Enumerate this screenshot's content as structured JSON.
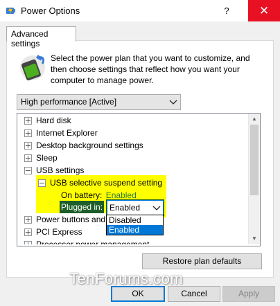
{
  "window": {
    "title": "Power Options",
    "help_glyph": "?",
    "close_glyph": "✕"
  },
  "tab": {
    "label": "Advanced settings"
  },
  "description": "Select the power plan that you want to customize, and then choose settings that reflect how you want your computer to manage power.",
  "plan_select": {
    "value": "High performance [Active]"
  },
  "tree": {
    "items": [
      {
        "label": "Hard disk",
        "expanded": false
      },
      {
        "label": "Internet Explorer",
        "expanded": false
      },
      {
        "label": "Desktop background settings",
        "expanded": false
      },
      {
        "label": "Sleep",
        "expanded": false
      },
      {
        "label": "USB settings",
        "expanded": true
      },
      {
        "label": "USB selective suspend setting",
        "expanded": true
      },
      {
        "label": "On battery:",
        "value": "Enabled"
      },
      {
        "label": "Plugged in:",
        "value": "Enabled"
      },
      {
        "label": "Power buttons and",
        "expanded": false
      },
      {
        "label": "PCI Express",
        "expanded": false
      },
      {
        "label": "Processor power management",
        "expanded": false
      }
    ]
  },
  "dropdown": {
    "options": [
      "Disabled",
      "Enabled"
    ],
    "selected": "Enabled"
  },
  "buttons": {
    "restore": "Restore plan defaults",
    "ok": "OK",
    "cancel": "Cancel",
    "apply": "Apply"
  },
  "watermark": "TenForums.com",
  "colors": {
    "highlight": "#ffff00",
    "accent": "#0078d7",
    "close": "#e81123",
    "value_green": "#2e7d32"
  }
}
